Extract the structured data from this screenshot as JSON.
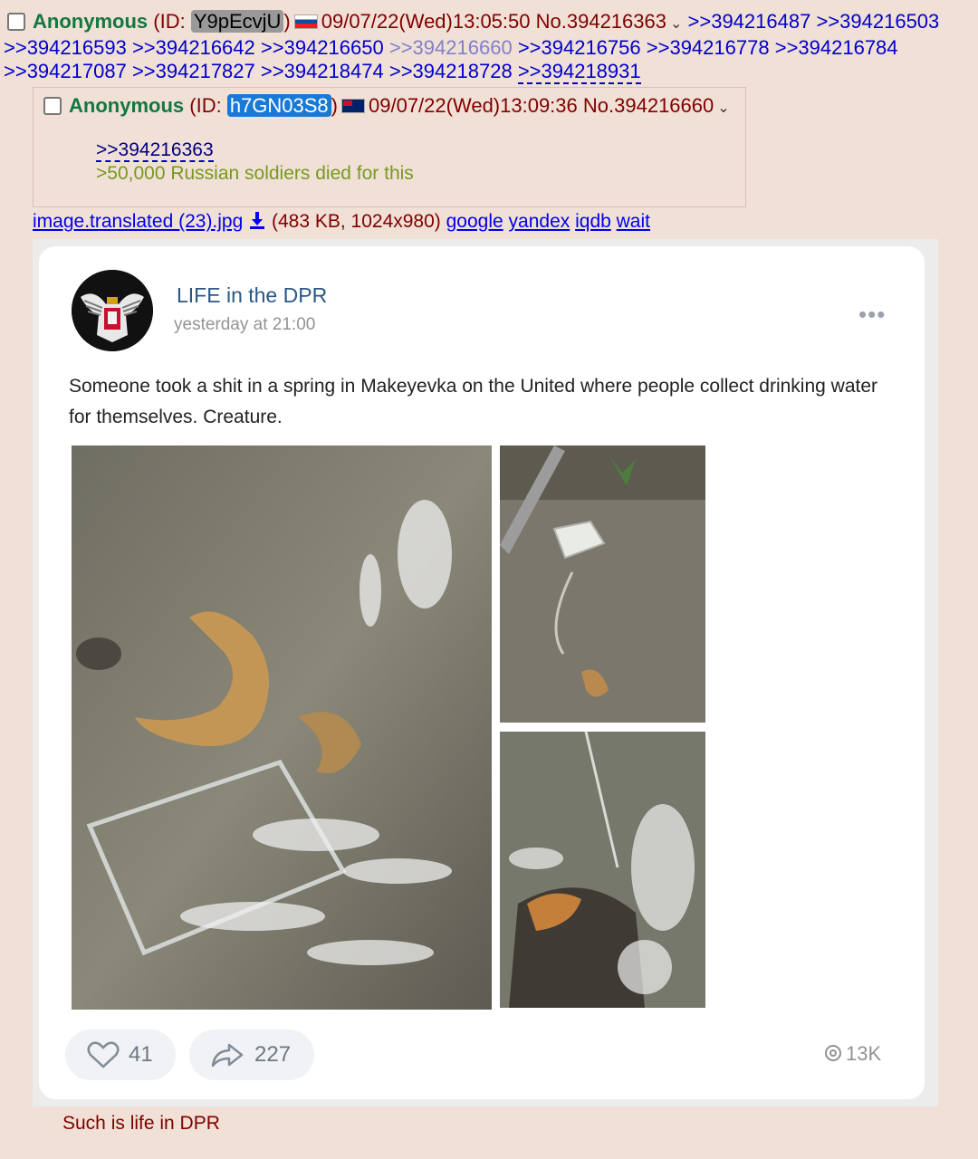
{
  "op": {
    "name": "Anonymous",
    "id_prefix": "(ID: ",
    "id": "Y9pEcvjU",
    "id_suffix": ")",
    "datetime": "09/07/22(Wed)13:05:50",
    "post_no": "No.394216363",
    "replies_line1": [
      ">>394216487",
      ">>394216503"
    ],
    "replies_line2": [
      ">>394216593",
      ">>394216642",
      ">>394216650",
      ">>394216660",
      ">>394216756",
      ">>394216778",
      ">>394216784"
    ],
    "replies_line3": [
      ">>394217087",
      ">>394217827",
      ">>394218474",
      ">>394218728",
      ">>394218931"
    ]
  },
  "reply": {
    "name": "Anonymous",
    "id_prefix": "(ID: ",
    "id": "h7GN03S8",
    "id_suffix": ")",
    "datetime": "09/07/22(Wed)13:09:36",
    "post_no": "No.394216660",
    "quote": ">>394216363",
    "greentext": ">50,000 Russian soldiers died for this"
  },
  "file": {
    "name": "image.translated (23).jpg",
    "info": "(483 KB, 1024x980)",
    "links": [
      "google",
      "yandex",
      "iqdb",
      "wait"
    ]
  },
  "post_card": {
    "author": "LIFE in the DPR",
    "time": "yesterday at 21:00",
    "text": "Someone took a shit in a spring in Makeyevka on the United where people collect drinking water for themselves. Creature.",
    "likes": "41",
    "shares": "227",
    "views": "13K"
  },
  "caption": "Such is life in DPR",
  "colors": {
    "board_bg": "#f0e0d6",
    "name_green": "#117743",
    "greentext": "#789922",
    "link_blue": "#0000cc",
    "vk_blue": "#2a5885"
  }
}
